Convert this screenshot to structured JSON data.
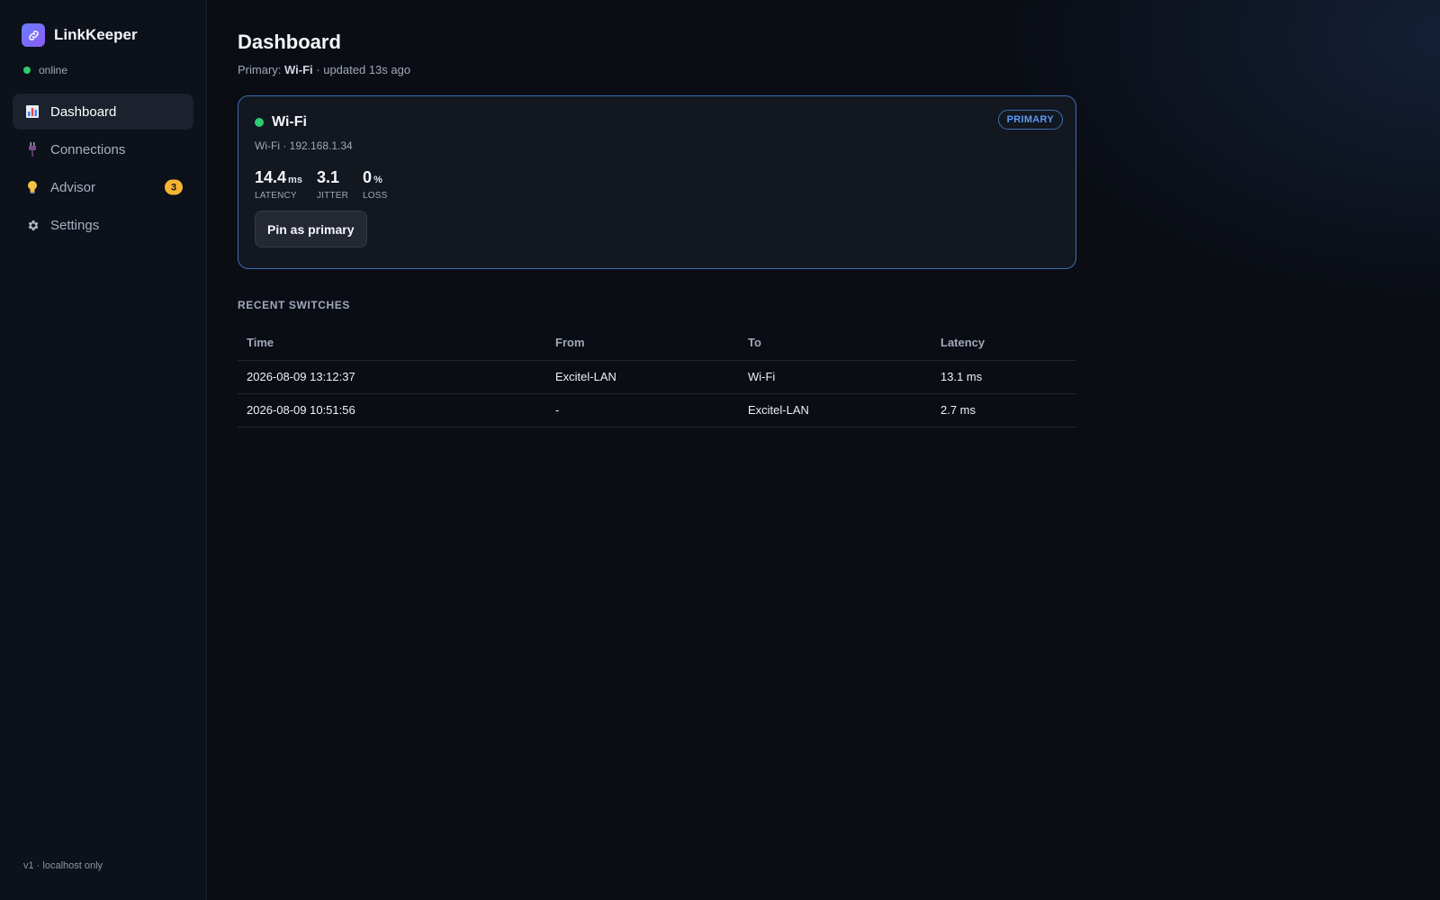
{
  "app": {
    "name": "LinkKeeper",
    "status": "online",
    "footer": "v1 · localhost only"
  },
  "sidebar": {
    "items": [
      {
        "label": "Dashboard",
        "icon": "bar-chart-icon",
        "active": true
      },
      {
        "label": "Connections",
        "icon": "plug-icon"
      },
      {
        "label": "Advisor",
        "icon": "lightbulb-icon",
        "badge": "3"
      },
      {
        "label": "Settings",
        "icon": "gear-icon"
      }
    ]
  },
  "page": {
    "title": "Dashboard",
    "subtitle_prefix": "Primary: ",
    "subtitle_primary": "Wi-Fi",
    "subtitle_suffix": " · updated 13s ago"
  },
  "card": {
    "name": "Wi-Fi",
    "badge": "PRIMARY",
    "sub": "Wi-Fi · 192.168.1.34",
    "metrics": [
      {
        "value": "14.4",
        "unit": "ms",
        "label": "LATENCY"
      },
      {
        "value": "3.1",
        "unit": "",
        "label": "JITTER"
      },
      {
        "value": "0",
        "unit": "%",
        "label": "LOSS"
      }
    ],
    "pin_label": "Pin as primary"
  },
  "switches": {
    "title": "RECENT SWITCHES",
    "headers": [
      "Time",
      "From",
      "To",
      "Latency"
    ],
    "rows": [
      [
        "2026-08-09 13:12:37",
        "Excitel-LAN",
        "Wi-Fi",
        "13.1 ms"
      ],
      [
        "2026-08-09 10:51:56",
        "-",
        "Excitel-LAN",
        "2.7 ms"
      ]
    ]
  },
  "colors": {
    "accent": "#3d6fb3",
    "online": "#2ecc71",
    "badge": "#f5b532"
  }
}
